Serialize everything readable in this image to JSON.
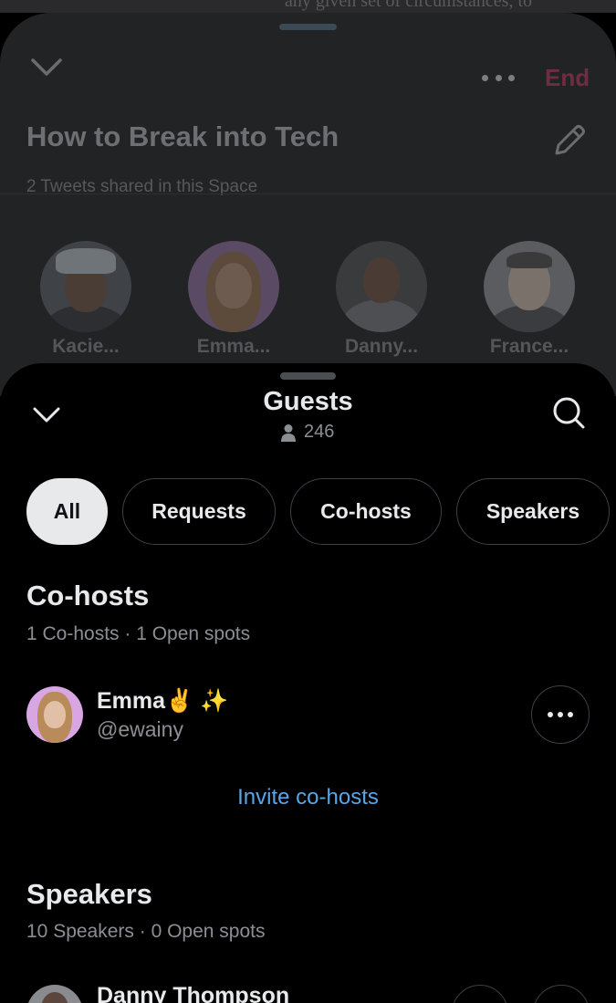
{
  "background_text": "any given set of circumstances, to",
  "space": {
    "end_label": "End",
    "title": "How to Break into Tech",
    "subtitle": "2 Tweets shared in this Space",
    "participants": [
      {
        "name": "Kacie..."
      },
      {
        "name": "Emma..."
      },
      {
        "name": "Danny..."
      },
      {
        "name": "France..."
      }
    ]
  },
  "guests": {
    "title": "Guests",
    "count": "246",
    "tabs": [
      {
        "label": "All",
        "active": true
      },
      {
        "label": "Requests",
        "active": false
      },
      {
        "label": "Co-hosts",
        "active": false
      },
      {
        "label": "Speakers",
        "active": false
      }
    ],
    "cohosts": {
      "title": "Co-hosts",
      "subtitle": "1 Co-hosts · 1 Open spots",
      "users": [
        {
          "name": "Emma✌️ ✨",
          "handle": "@ewainy"
        }
      ],
      "invite_label": "Invite co-hosts"
    },
    "speakers": {
      "title": "Speakers",
      "subtitle": "10 Speakers · 0 Open spots",
      "users": [
        {
          "name": "Danny Thompson"
        }
      ]
    }
  },
  "colors": {
    "background": "#000000",
    "end_accent": "#f4212e",
    "link": "#58a6e6"
  }
}
